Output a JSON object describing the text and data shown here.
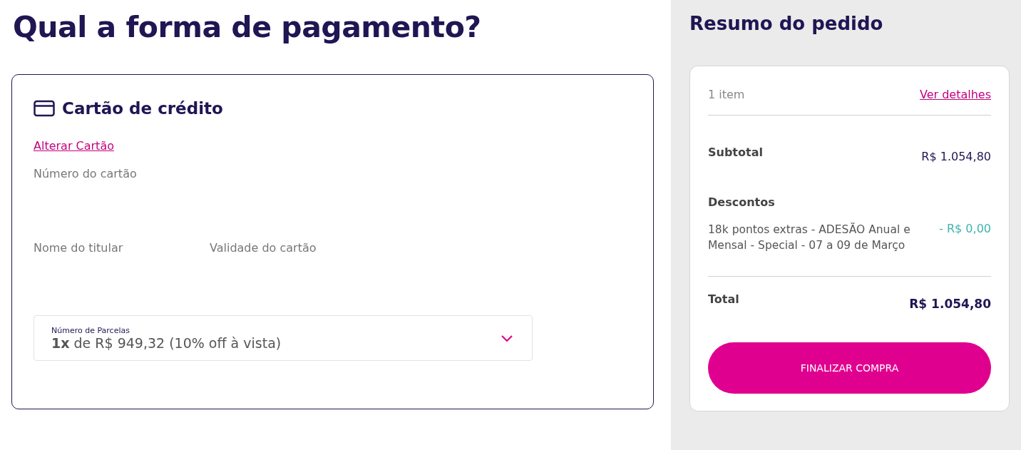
{
  "page_title": "Qual a forma de pagamento?",
  "payment_card": {
    "title": "Cartão de crédito",
    "change_link": "Alterar Cartão",
    "card_number_label": "Número do cartão",
    "holder_label": "Nome do titular",
    "expiry_label": "Validade do cartão",
    "installments": {
      "label": "Número de Parcelas",
      "value": "**1x** de R$ 949,32 (10% off à vista)"
    }
  },
  "summary": {
    "title": "Resumo do pedido",
    "item_count": "1 item",
    "details_link": "Ver detalhes",
    "subtotal_label": "Subtotal",
    "subtotal_value": "R$ 1.054,80",
    "discounts_label": "Descontos",
    "discounts": [
      {
        "description": "18k pontos extras - ADESÃO Anual e Mensal - Special - 07 a 09 de Março",
        "amount": "- R$ 0,00"
      }
    ],
    "total_label": "Total",
    "total_value": "R$ 1.054,80",
    "checkout_button": "FINALIZAR COMPRA"
  }
}
